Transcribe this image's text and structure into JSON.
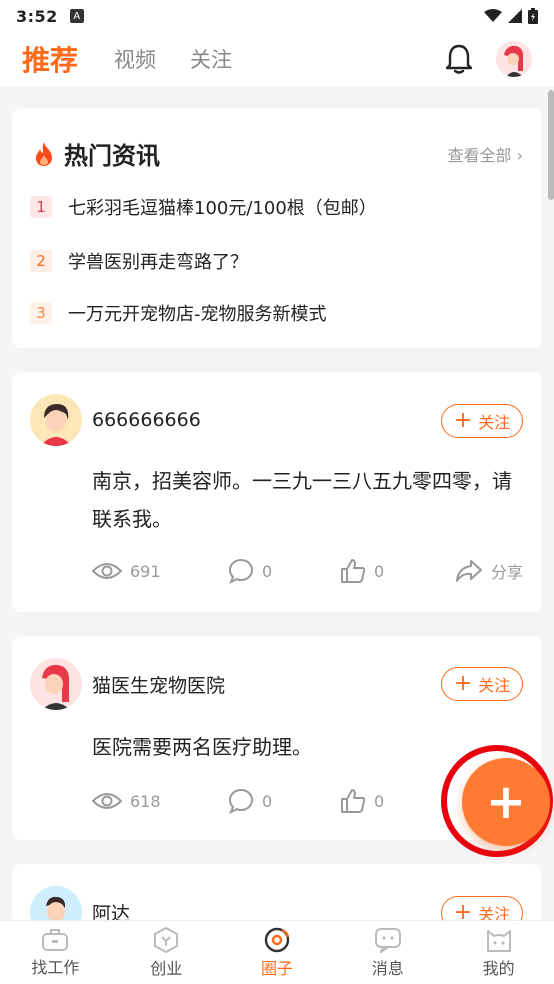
{
  "status": {
    "time": "3:52",
    "badge": "A"
  },
  "header": {
    "tabs": [
      {
        "label": "推荐",
        "active": true
      },
      {
        "label": "视频",
        "active": false
      },
      {
        "label": "关注",
        "active": false
      }
    ]
  },
  "hot": {
    "title": "热门资讯",
    "see_all": "查看全部",
    "items": [
      {
        "rank": "1",
        "text": "七彩羽毛逗猫棒100元/100根（包邮）"
      },
      {
        "rank": "2",
        "text": "学兽医别再走弯路了？"
      },
      {
        "rank": "3",
        "text": "一万元开宠物店-宠物服务新模式"
      }
    ]
  },
  "posts": [
    {
      "username": "666666666",
      "follow_label": "关注",
      "text": "南京，招美容师。一三九一三八五九零四零，请联系我。",
      "views": "691",
      "comments": "0",
      "likes": "0",
      "share_label": "分享"
    },
    {
      "username": "猫医生宠物医院",
      "follow_label": "关注",
      "text": "医院需要两名医疗助理。",
      "views": "618",
      "comments": "0",
      "likes": "0"
    },
    {
      "username": "阿达",
      "follow_label": "关注"
    }
  ],
  "fab": {
    "label": "+"
  },
  "nav": [
    {
      "label": "找工作",
      "icon": "briefcase-icon"
    },
    {
      "label": "创业",
      "icon": "startup-icon"
    },
    {
      "label": "圈子",
      "icon": "circle-icon",
      "active": true
    },
    {
      "label": "消息",
      "icon": "message-icon"
    },
    {
      "label": "我的",
      "icon": "cat-face-icon"
    }
  ],
  "colors": {
    "accent": "#ff6a1a",
    "fab_ring": "#e8000f"
  }
}
